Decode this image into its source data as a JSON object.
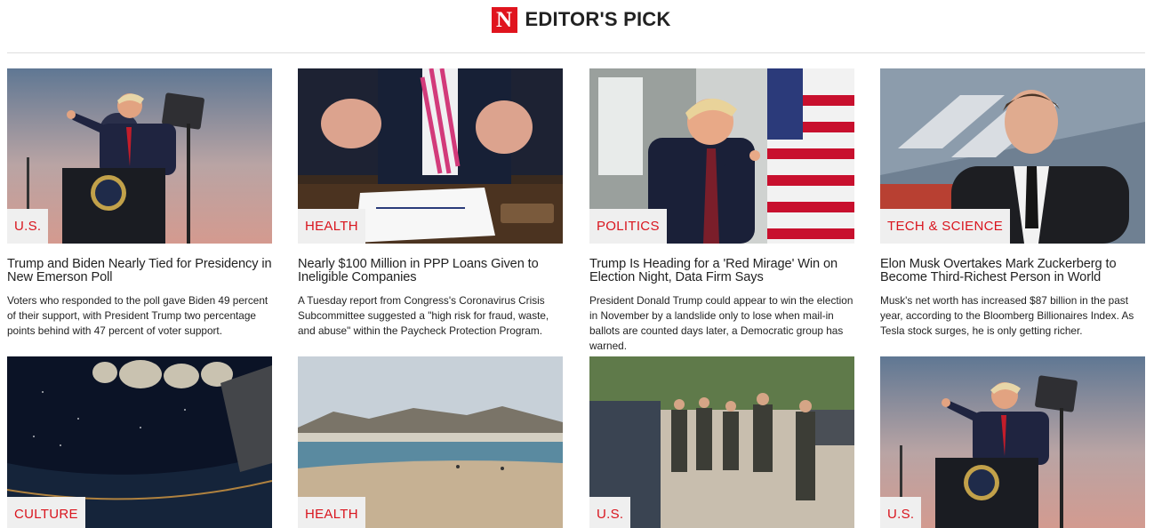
{
  "header": {
    "logo_letter": "N",
    "title": "EDITOR'S PICK"
  },
  "cards": [
    {
      "tag": "U.S.",
      "title": "Trump and Biden Nearly Tied for Presidency in New Emerson Poll",
      "summary": "Voters who responded to the poll gave Biden 49 percent of their support, with President Trump two percentage points behind with 47 percent of voter support."
    },
    {
      "tag": "HEALTH",
      "title": "Nearly $100 Million in PPP Loans Given to Ineligible Companies",
      "summary": "A Tuesday report from Congress's Coronavirus Crisis Subcommittee suggested a \"high risk for fraud, waste, and abuse\" within the Paycheck Protection Program."
    },
    {
      "tag": "POLITICS",
      "title": "Trump Is Heading for a 'Red Mirage' Win on Election Night, Data Firm Says",
      "summary": "President Donald Trump could appear to win the election in November by a landslide only to lose when mail-in ballots are counted days later, a Democratic group has warned."
    },
    {
      "tag": "TECH & SCIENCE",
      "title": "Elon Musk Overtakes Mark Zuckerberg to Become Third-Richest Person in World",
      "summary": "Musk's net worth has increased $87 billion in the past year, according to the Bloomberg Billionaires Index. As Tesla stock surges, he is only getting richer."
    },
    {
      "tag": "CULTURE"
    },
    {
      "tag": "HEALTH"
    },
    {
      "tag": "U.S."
    },
    {
      "tag": "U.S."
    }
  ]
}
